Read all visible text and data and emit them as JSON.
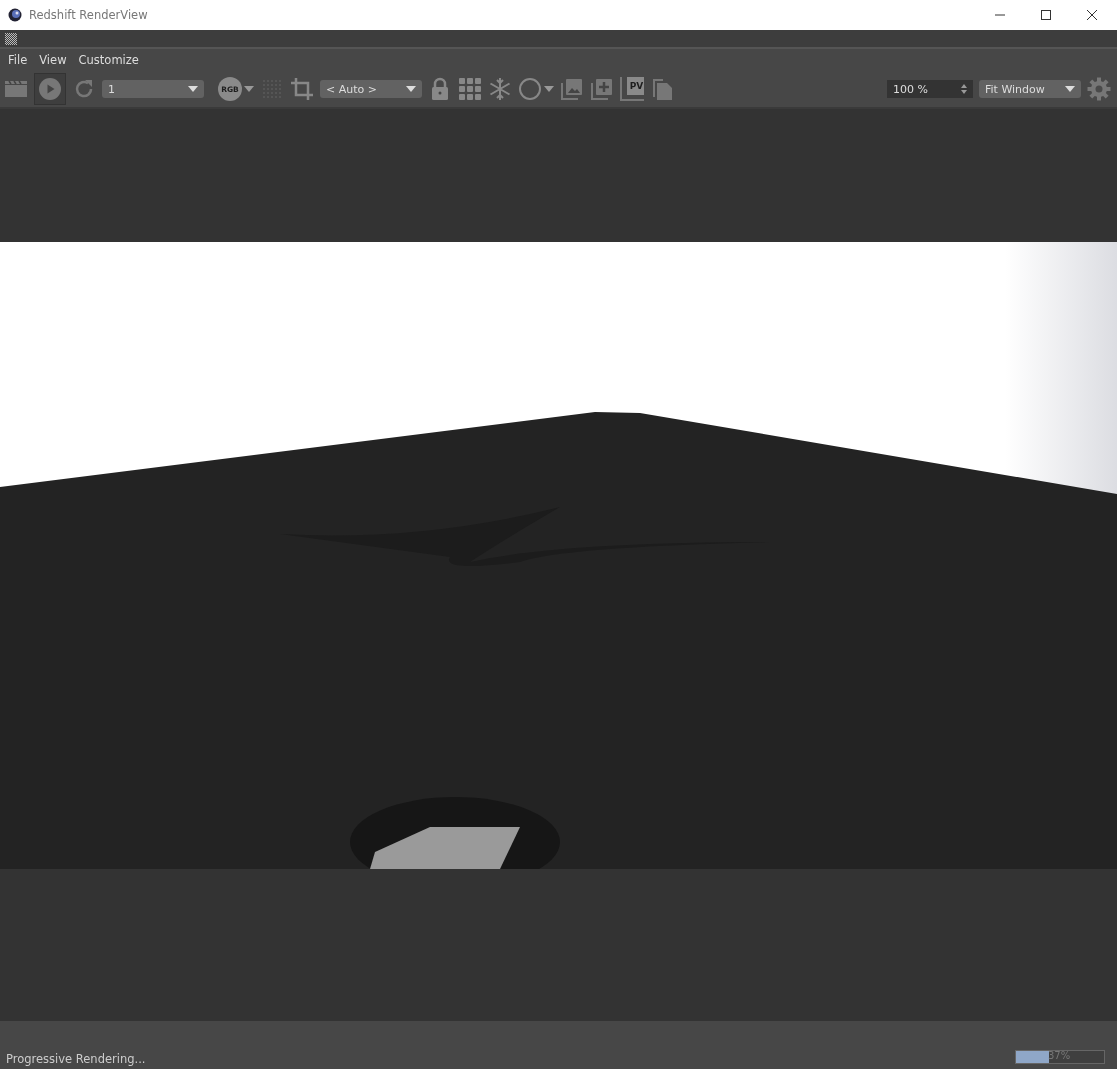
{
  "window": {
    "title": "Redshift RenderView"
  },
  "menu": [
    {
      "label": "File"
    },
    {
      "label": "View"
    },
    {
      "label": "Customize"
    }
  ],
  "toolbar": {
    "play_selected": true,
    "aov_select": "1",
    "channel_button": "RGB",
    "region_select": "< Auto >",
    "pv_label": "PV",
    "zoom_field": "100 %",
    "fit_select": "Fit Window"
  },
  "status_bar": {
    "text": "Progressive Rendering...",
    "progress": {
      "level": 0.37,
      "reading": "37%"
    }
  }
}
